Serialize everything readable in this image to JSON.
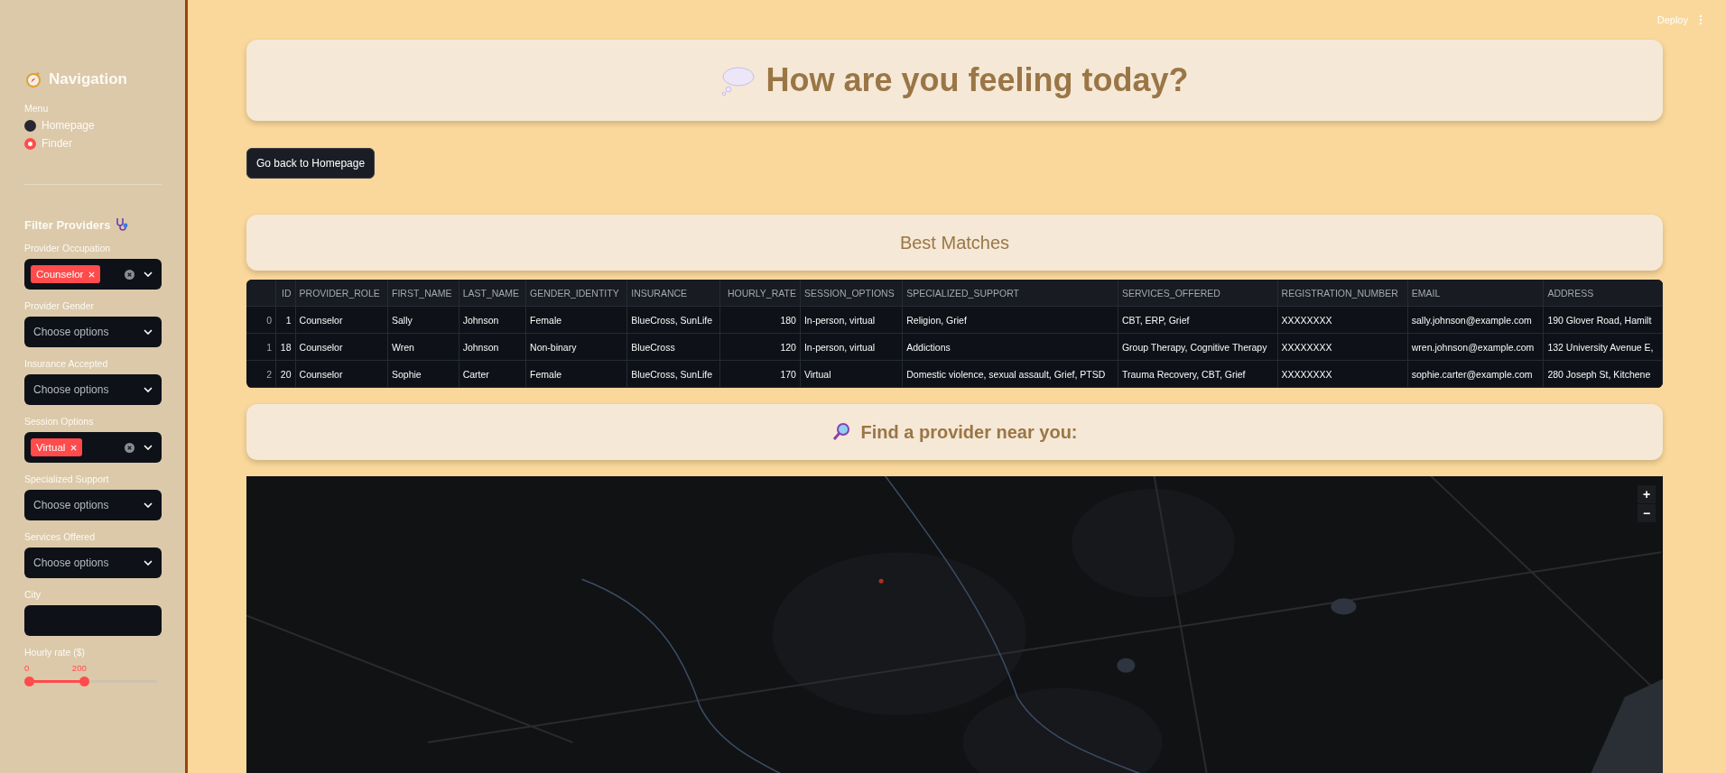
{
  "top_bar": {
    "deploy": "Deploy"
  },
  "sidebar": {
    "title": "Navigation",
    "menu_label": "Menu",
    "menu": [
      {
        "label": "Homepage",
        "selected": false
      },
      {
        "label": "Finder",
        "selected": true
      }
    ],
    "filter_title": "Filter Providers",
    "filters": [
      {
        "kind": "multiselect",
        "label": "Provider Occupation",
        "tags": [
          "Counselor"
        ]
      },
      {
        "kind": "multiselect",
        "label": "Provider Gender",
        "placeholder": "Choose options"
      },
      {
        "kind": "multiselect",
        "label": "Insurance Accepted",
        "placeholder": "Choose options"
      },
      {
        "kind": "multiselect",
        "label": "Session Options",
        "tags": [
          "Virtual"
        ]
      },
      {
        "kind": "multiselect",
        "label": "Specialized Support",
        "placeholder": "Choose options"
      },
      {
        "kind": "multiselect",
        "label": "Services Offered",
        "placeholder": "Choose options"
      },
      {
        "kind": "text",
        "label": "City"
      },
      {
        "kind": "slider",
        "label": "Hourly rate ($)",
        "min_label": "0",
        "max_label": "200",
        "level": 0.4
      }
    ]
  },
  "header": {
    "title": "How are you feeling today?"
  },
  "back_button": "Go back to Homepage",
  "matches_title": "Best Matches",
  "table": {
    "columns": [
      "",
      "ID",
      "PROVIDER_ROLE",
      "FIRST_NAME",
      "LAST_NAME",
      "GENDER_IDENTITY",
      "INSURANCE",
      "HOURLY_RATE",
      "SESSION_OPTIONS",
      "SPECIALIZED_SUPPORT",
      "SERVICES_OFFERED",
      "REGISTRATION_NUMBER",
      "EMAIL",
      "ADDRESS"
    ],
    "rows": [
      [
        "0",
        "1",
        "Counselor",
        "Sally",
        "Johnson",
        "Female",
        "BlueCross, SunLife",
        "180",
        "In-person, virtual",
        "Religion, Grief",
        "CBT, ERP, Grief",
        "XXXXXXXX",
        "sally.johnson@example.com",
        "190 Glover Road, Hamilt"
      ],
      [
        "1",
        "18",
        "Counselor",
        "Wren",
        "Johnson",
        "Non-binary",
        "BlueCross",
        "120",
        "In-person, virtual",
        "Addictions",
        "Group Therapy, Cognitive Therapy",
        "XXXXXXXX",
        "wren.johnson@example.com",
        "132 University Avenue E,"
      ],
      [
        "2",
        "20",
        "Counselor",
        "Sophie",
        "Carter",
        "Female",
        "BlueCross, SunLife",
        "170",
        "Virtual",
        "Domestic violence, sexual assault, Grief, PTSD",
        "Trauma Recovery, CBT, Grief",
        "XXXXXXXX",
        "sophie.carter@example.com",
        "280 Joseph St, Kitchene"
      ]
    ]
  },
  "map_title": "Find a provider near you:",
  "map": {
    "kind": "picture",
    "zoom_in": "+",
    "zoom_out": "−"
  }
}
